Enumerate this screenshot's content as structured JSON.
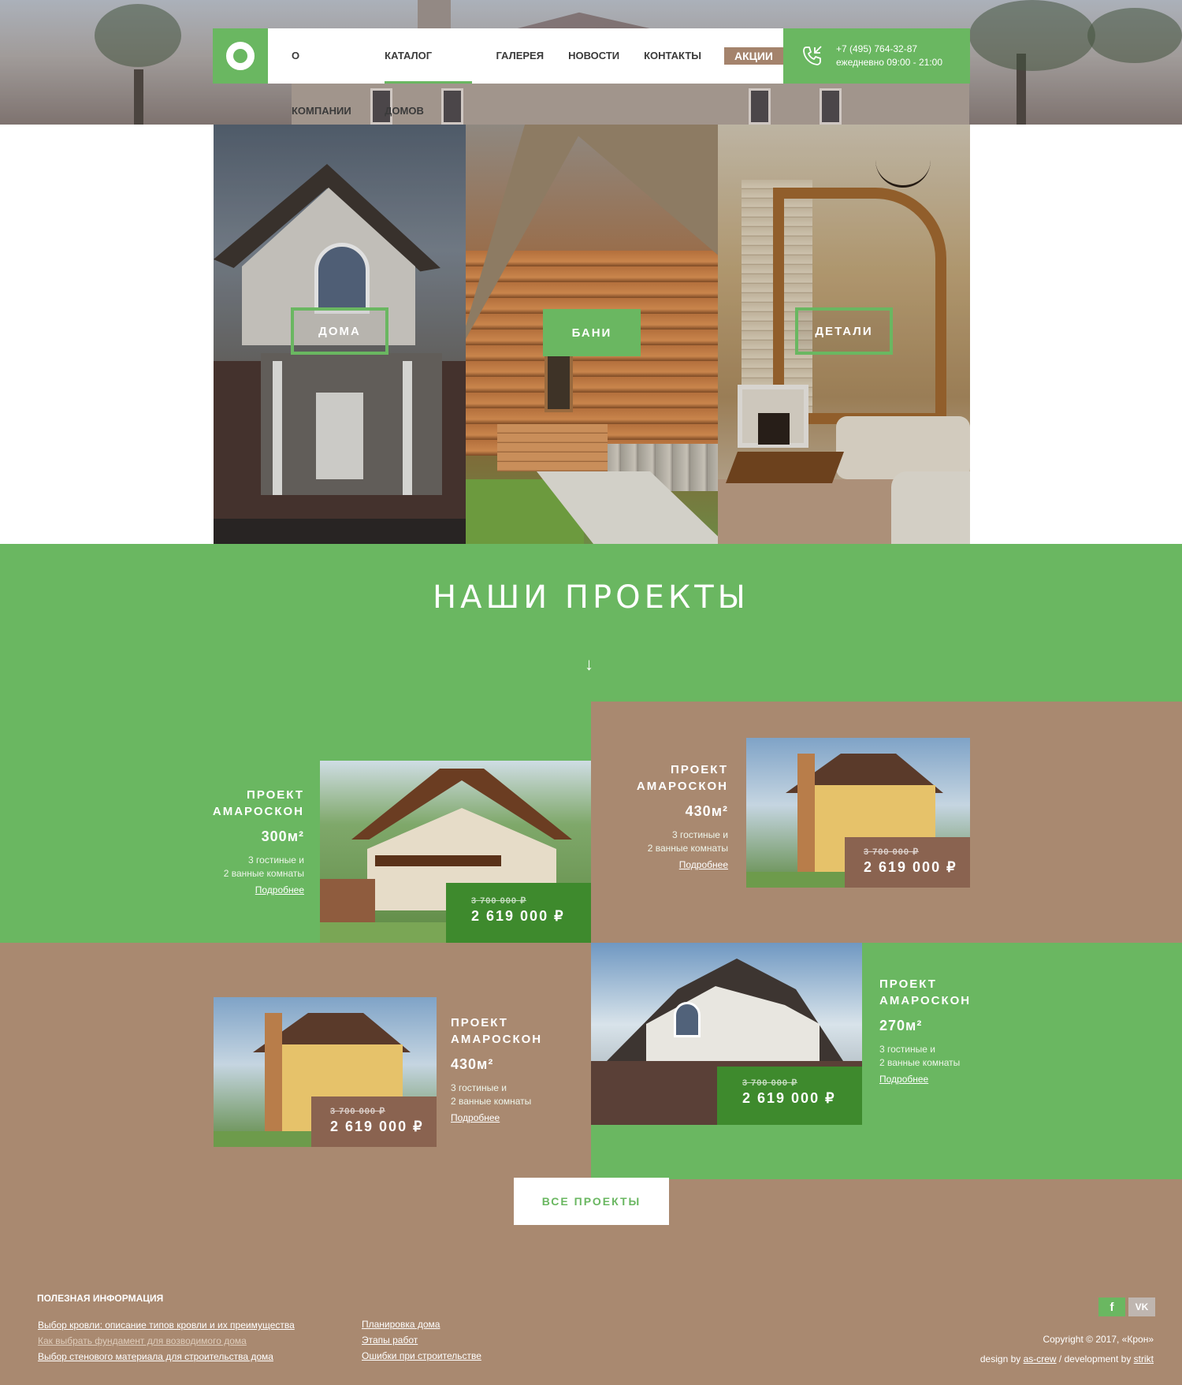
{
  "header": {
    "nav": [
      {
        "label": "О КОМПАНИИ",
        "active": false
      },
      {
        "label": "КАТАЛОГ ДОМОВ",
        "active": true
      },
      {
        "label": "ГАЛЕРЕЯ",
        "active": false
      },
      {
        "label": "НОВОСТИ",
        "active": false
      },
      {
        "label": "КОНТАКТЫ",
        "active": false
      }
    ],
    "promo_label": "АКЦИИ",
    "phone": "+7 (495) 764-32-87",
    "hours": "ежедневно 09:00 - 21:00",
    "icons": {
      "logo": "ring-logo-icon",
      "phone": "phone-icon"
    }
  },
  "categories": [
    {
      "label": "ДОМА"
    },
    {
      "label": "БАНИ"
    },
    {
      "label": "ДЕТАЛИ"
    }
  ],
  "projects": {
    "title": "НАШИ ПРОЕКТЫ",
    "arrow": "↓",
    "cards": [
      {
        "name_line1": "ПРОЕКТ",
        "name_line2": "АМАРОСКОН",
        "area": "300м²",
        "desc_line1": "3 гостиные и",
        "desc_line2": "2 ванные комнаты",
        "more": "Подробнее",
        "old_price": "3 700 000 ₽",
        "price": "2 619 000 ₽"
      },
      {
        "name_line1": "ПРОЕКТ",
        "name_line2": "АМАРОСКОН",
        "area": "430м²",
        "desc_line1": "3 гостиные и",
        "desc_line2": "2 ванные комнаты",
        "more": "Подробнее",
        "old_price": "3 700 000 ₽",
        "price": "2 619 000 ₽"
      },
      {
        "name_line1": "ПРОЕКТ",
        "name_line2": "АМАРОСКОН",
        "area": "430м²",
        "desc_line1": "3 гостиные и",
        "desc_line2": "2 ванные комнаты",
        "more": "Подробнее",
        "old_price": "3 700 000 ₽",
        "price": "2 619 000 ₽"
      },
      {
        "name_line1": "ПРОЕКТ",
        "name_line2": "АМАРОСКОН",
        "area": "270м²",
        "desc_line1": "3 гостиные и",
        "desc_line2": "2 ванные комнаты",
        "more": "Подробнее",
        "old_price": "3 700 000 ₽",
        "price": "2 619 000 ₽"
      }
    ],
    "all_button": "ВСЕ ПРОЕКТЫ"
  },
  "footer": {
    "title": "ПОЛЕЗНАЯ ИНФОРМАЦИЯ",
    "links_col1": [
      "Выбор кровли: описание типов кровли и их преимущества",
      "Как выбрать фундамент для возводимого дома",
      "Выбор стенового материала для строительства дома"
    ],
    "links_col2": [
      "Планировка дома",
      "Этапы работ",
      "Ошибки при строительстве"
    ],
    "social": {
      "fb": "f",
      "vk": "VK"
    },
    "copyright": "Copyright ©  2017, «Крон»",
    "design_prefix": "design by ",
    "design_link": "as-crew",
    "dev_prefix": " / development by ",
    "dev_link": "strikt"
  },
  "colors": {
    "green": "#6ab761",
    "brown": "#a98970",
    "dark_green": "#3e8a2d",
    "dark_brown": "#8a6350"
  }
}
